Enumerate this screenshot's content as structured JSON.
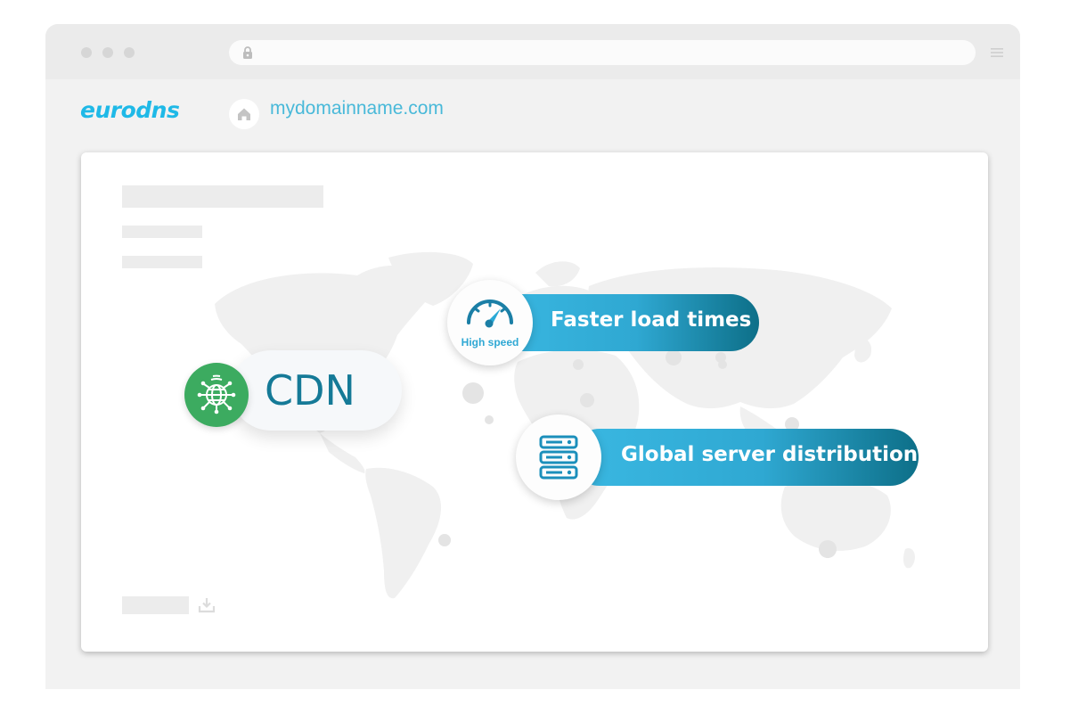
{
  "browser": {
    "address_bar_value": "",
    "brand_logo": "eurodns",
    "site_domain": "mydomainname.com"
  },
  "features": {
    "main": "CDN",
    "speed_badge": "High speed",
    "speed_label": "Faster load times",
    "servers_label": "Global server distribution"
  },
  "colors": {
    "brand": "#1fb9e7",
    "pill_gradient_start": "#3ab8e2",
    "pill_gradient_end": "#0d6f88",
    "cdn_text": "#157a97",
    "cdn_icon_bg": "#3cab60"
  },
  "icons": {
    "window_controls": [
      "window-dot-icon",
      "window-dot-icon",
      "window-dot-icon"
    ],
    "lock": "lock-icon",
    "menu": "hamburger-menu-icon",
    "home": "home-icon",
    "download": "download-icon",
    "cdn": "globe-network-icon",
    "speed": "speedometer-icon",
    "servers": "server-stack-icon"
  }
}
